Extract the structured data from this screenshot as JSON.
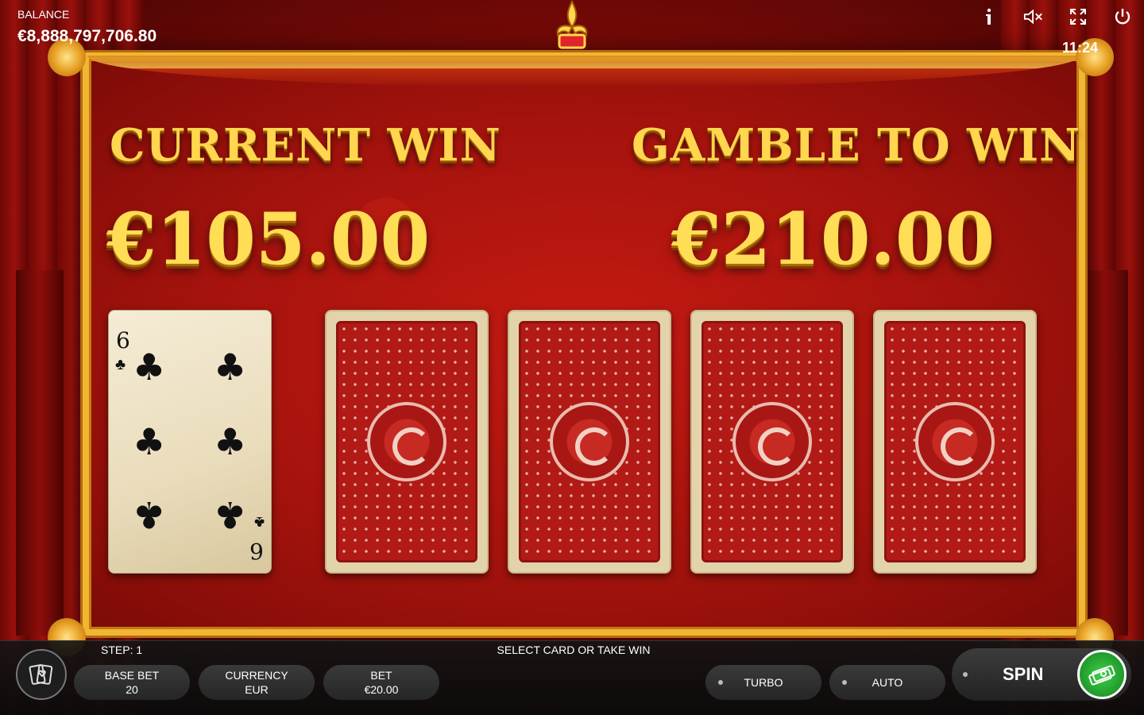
{
  "hud": {
    "balance_label": "BALANCE",
    "balance_value": "€8,888,797,706.80",
    "clock": "11:24",
    "icons": [
      "info-icon",
      "mute-icon",
      "fullscreen-icon",
      "power-icon"
    ]
  },
  "gamble": {
    "current_win_label": "CURRENT WIN",
    "current_win_amount": "€105.00",
    "gamble_label": "GAMBLE TO WIN",
    "gamble_amount": "€210.00",
    "dealer_card": {
      "rank": "6",
      "suit": "♣"
    },
    "hidden_cards": 4
  },
  "bottom": {
    "step": "STEP: 1",
    "message": "SELECT CARD OR TAKE WIN",
    "base_bet_label": "BASE BET",
    "base_bet_value": "20",
    "currency_label": "CURRENCY",
    "currency_value": "EUR",
    "bet_label": "BET",
    "bet_value": "€20.00",
    "turbo_label": "TURBO",
    "auto_label": "AUTO",
    "spin_label": "SPIN"
  },
  "colors": {
    "gold": "#ffd64d",
    "felt_red": "#b21a16",
    "spin_green": "#2fb83a"
  }
}
